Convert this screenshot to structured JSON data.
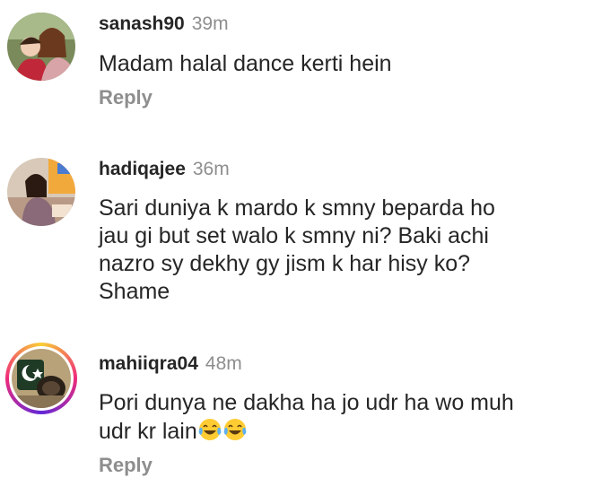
{
  "comments": [
    {
      "username": "sanash90",
      "time": "39m",
      "text": "Madam halal dance kerti hein",
      "reply_label": "Reply",
      "has_story_ring": false
    },
    {
      "username": "hadiqajee",
      "time": "36m",
      "text": "Sari duniya k mardo k smny beparda ho\njau gi but set walo k smny ni? Baki achi\nnazro sy dekhy gy jism k har hisy ko?\nShame",
      "has_story_ring": false
    },
    {
      "username": "mahiiqra04",
      "time": "48m",
      "text_line1": "Pori dunya ne dakha ha jo udr ha wo muh",
      "text_line2": "udr kr lain",
      "emoji": [
        "tears-of-joy-emoji",
        "tears-of-joy-emoji"
      ],
      "reply_label": "Reply",
      "has_story_ring": true
    }
  ]
}
